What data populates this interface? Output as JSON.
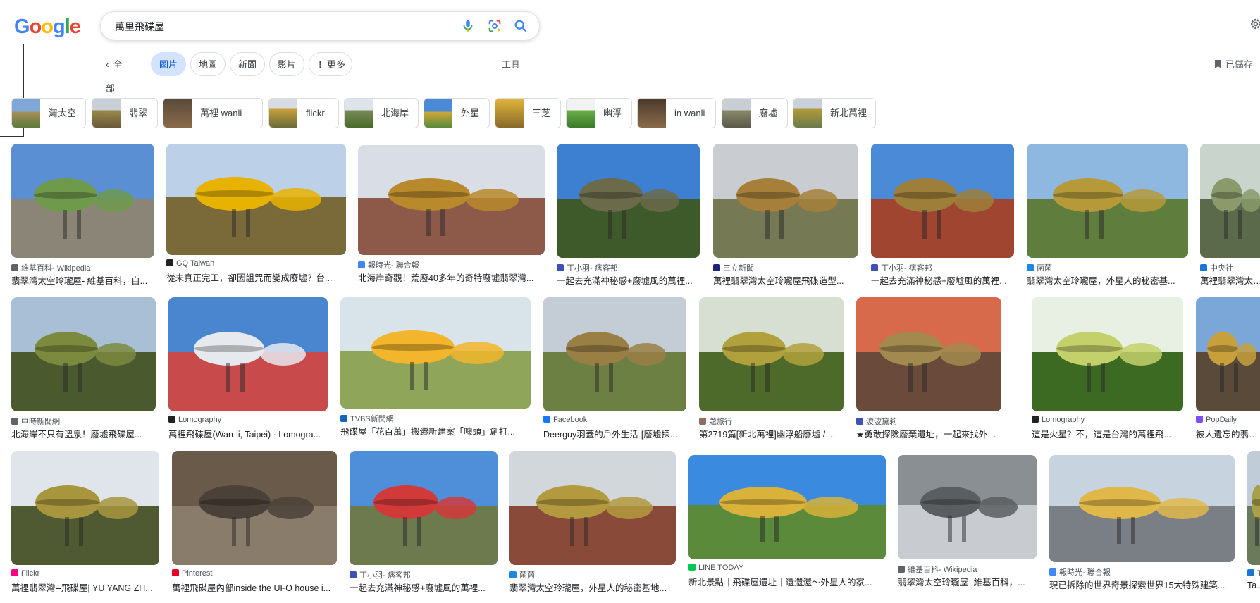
{
  "logo": {
    "letters": [
      "G",
      "o",
      "o",
      "g",
      "l",
      "e"
    ],
    "colors": [
      "#4285f4",
      "#ea4335",
      "#fbbc05",
      "#4285f4",
      "#34a853",
      "#ea4335"
    ]
  },
  "search": {
    "query": "萬里飛碟屋"
  },
  "nav": {
    "back_label": "全部",
    "tabs": [
      "圖片",
      "地圖",
      "新聞",
      "影片",
      "更多"
    ],
    "active": "圖片",
    "tools": "工具",
    "saved": "已儲存"
  },
  "chips": [
    "灣太空",
    "翡翠",
    "萬裡 wanli",
    "flickr",
    "北海岸",
    "外星",
    "三芝",
    "幽浮",
    "in wanli",
    "廢墟",
    "新北萬裡"
  ],
  "results": [
    {
      "source": "維基百科- Wikipedia",
      "title": "翡翠灣太空玲瓏屋- 維基百科，自...",
      "fav": "#5f6368",
      "palette": [
        "#5b8fd4",
        "#6f9a4b",
        "#8a8577"
      ]
    },
    {
      "source": "GQ Taiwan",
      "title": "從未真正完工，卻因詛咒而變成廢墟？台...",
      "fav": "#202124",
      "palette": [
        "#bcd0e8",
        "#e8b300",
        "#7a6a3a"
      ]
    },
    {
      "source": "報時光- 聯合報",
      "title": "北海岸奇觀！荒廢40多年的奇特廢墟翡翠灣...",
      "fav": "#4285f4",
      "palette": [
        "#d8dde6",
        "#b98a2c",
        "#8d5a4a"
      ]
    },
    {
      "source": "丁小羽- 痞客邦",
      "title": "一起去充滿神秘感+廢墟風的萬裡...",
      "fav": "#3f51b5",
      "palette": [
        "#3d7fd0",
        "#6b6a4a",
        "#3e5a2a"
      ]
    },
    {
      "source": "三立新聞",
      "title": "萬裡翡翠灣太空玲瓏屋飛碟造型...",
      "fav": "#1a237e",
      "palette": [
        "#c9ccd1",
        "#a6803a",
        "#757a55"
      ]
    },
    {
      "source": "丁小羽- 痞客邦",
      "title": "一起去充滿神秘感+廢墟風的萬裡...",
      "fav": "#3f51b5",
      "palette": [
        "#4b8ad6",
        "#9e7f3a",
        "#a0452f"
      ]
    },
    {
      "source": "菌菌",
      "title": "翡翠灣太空玲瓏屋，外星人的秘密基...",
      "fav": "#1e88e5",
      "palette": [
        "#8fb8e0",
        "#b69a3a",
        "#5f7d3c"
      ]
    },
    {
      "source": "中央社",
      "title": "萬裡翡翠灣太空玲瓏屋...",
      "fav": "#1976d2",
      "palette": [
        "#c8d4cc",
        "#8a9a6a",
        "#5b6a4b"
      ]
    },
    {
      "source": "中時新聞網",
      "title": "北海岸不只有溫泉！廢墟飛碟屋...",
      "fav": "#5f6368",
      "palette": [
        "#a9bfd6",
        "#7c8a3e",
        "#4a5a2e"
      ]
    },
    {
      "source": "Lomography",
      "title": "萬裡飛碟屋(Wan-li, Taipei) · Lomogra...",
      "fav": "#202124",
      "palette": [
        "#4a86d0",
        "#e6e9ee",
        "#c84a4a"
      ]
    },
    {
      "source": "TVBS新聞網",
      "title": "飛碟屋「花百萬」搬遷新建案「噱頭」創打...",
      "fav": "#1565c0",
      "palette": [
        "#d9e3ea",
        "#f2b52c",
        "#8fa65a"
      ]
    },
    {
      "source": "Facebook",
      "title": "Deerguy羽蓋的戶外生活-[廢墟探...",
      "fav": "#1877f2",
      "palette": [
        "#c4ccd6",
        "#9a7f45",
        "#6c8044"
      ]
    },
    {
      "source": "蔻旅行",
      "title": "第2719篇[新北萬裡]幽浮船廢墟 / ...",
      "fav": "#8d6e63",
      "palette": [
        "#d7dfd3",
        "#b1a13c",
        "#4e6a2a"
      ]
    },
    {
      "source": "波波黛莉",
      "title": "★勇敢探險廢棄遺址，一起來找外星人...",
      "fav": "#3f51b5",
      "palette": [
        "#d66a4a",
        "#a28a4f",
        "#6a4a3a"
      ]
    },
    {
      "source": "Lomography",
      "title": "這是火星？不，這是台灣的萬裡飛...",
      "fav": "#202124",
      "palette": [
        "#e8efe3",
        "#c4d16a",
        "#3c6a22"
      ]
    },
    {
      "source": "PopDaily",
      "title": "被人遺忘的翡翠灣...",
      "fav": "#7c4dff",
      "palette": [
        "#7aa6d8",
        "#c7a03c",
        "#5a4a3a"
      ]
    },
    {
      "source": "Flickr",
      "title": "萬裡翡翠灣--飛碟屋| YU YANG ZH...",
      "fav": "#ff0084",
      "palette": [
        "#dfe5ea",
        "#a7963e",
        "#4f5a32"
      ]
    },
    {
      "source": "Pinterest",
      "title": "萬裡飛碟屋內部inside the UFO house i...",
      "fav": "#e60023",
      "palette": [
        "#6a5a4a",
        "#4a4238",
        "#8a7c6a"
      ]
    },
    {
      "source": "丁小羽- 痞客邦",
      "title": "一起去充滿神秘感+廢墟風的萬裡...",
      "fav": "#3f51b5",
      "palette": [
        "#4f8fda",
        "#d23a3a",
        "#6c7a4e"
      ]
    },
    {
      "source": "菌菌",
      "title": "翡翠灣太空玲瓏屋，外星人的秘密基地...",
      "fav": "#1e88e5",
      "palette": [
        "#d2d7dc",
        "#b39a3e",
        "#8a4a3a"
      ]
    },
    {
      "source": "LINE TODAY",
      "title": "新北景點｜飛碟屋遺址｜還還還～外星人的家...",
      "fav": "#06c755",
      "palette": [
        "#3a8ae0",
        "#d8b23a",
        "#5a8a3a"
      ]
    },
    {
      "source": "維基百科- Wikipedia",
      "title": "翡翠灣太空玲瓏屋- 維基百科，...",
      "fav": "#5f6368",
      "palette": [
        "#8a8f94",
        "#5a5e60",
        "#c8ccd0"
      ]
    },
    {
      "source": "報時光- 聯合報",
      "title": "現已拆除的世界奇景探索世界15大特殊建築...",
      "fav": "#4285f4",
      "palette": [
        "#c7d3df",
        "#e0b84a",
        "#7a7f86"
      ]
    },
    {
      "source": "Ta",
      "title": "Ta...",
      "fav": "#1976d2",
      "palette": [
        "#c0ccd8",
        "#a8a04a",
        "#6a7a5a"
      ]
    }
  ]
}
